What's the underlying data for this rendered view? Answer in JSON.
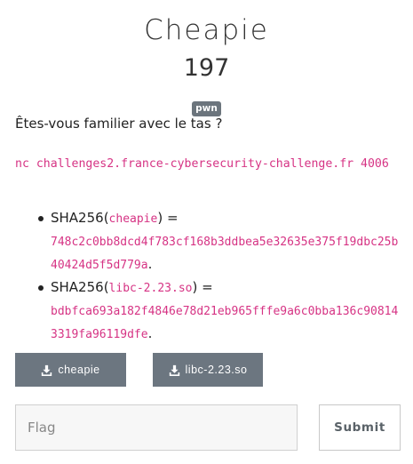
{
  "challenge": {
    "name": "Cheapie",
    "points": "197",
    "category": "pwn",
    "description": "Êtes-vous familier avec le tas ?",
    "command": "nc challenges2.france-cybersecurity-challenge.fr 4006"
  },
  "hashes": [
    {
      "prefix": "SHA256(",
      "file": "cheapie",
      "suffix": ") =",
      "hash": "748c2c0bb8dcd4f783cf168b3ddbea5e32635e375f19dbc25b40424d5f5d779a",
      "end": "."
    },
    {
      "prefix": "SHA256(",
      "file": "libc-2.23.so",
      "suffix": ") =",
      "hash": "bdbfca693a182f4846e78d21eb965fffe9a6c0bba136c908143319fa96119dfe",
      "end": "."
    }
  ],
  "downloads": [
    {
      "label": "cheapie",
      "icon": "download-icon"
    },
    {
      "label": "libc-2.23.so",
      "icon": "download-icon"
    }
  ],
  "flag_form": {
    "placeholder": "Flag",
    "submit_label": "Submit"
  },
  "colors": {
    "code": "#d63384",
    "button": "#6c7680",
    "badge": "#6c757d"
  }
}
